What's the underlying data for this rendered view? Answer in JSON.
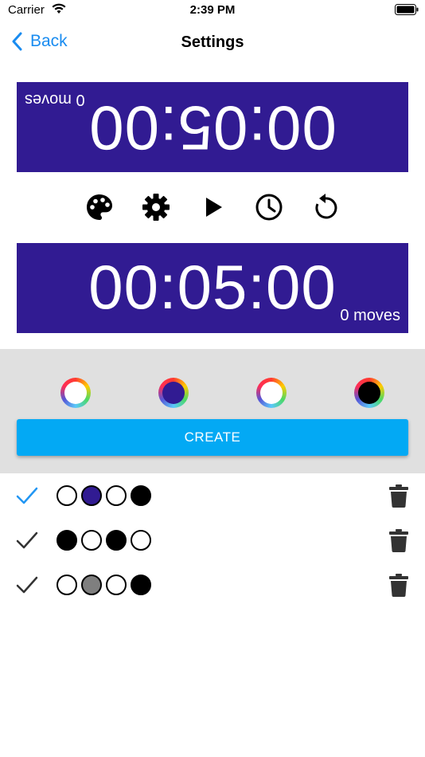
{
  "status_bar": {
    "carrier": "Carrier",
    "time": "2:39 PM"
  },
  "nav": {
    "back_label": "Back",
    "title": "Settings"
  },
  "clocks": {
    "top": {
      "time": "00:05:00",
      "moves": "0 moves",
      "background": "#311b92",
      "text_color": "#ffffff"
    },
    "bottom": {
      "time": "00:05:00",
      "moves": "0 moves",
      "background": "#311b92",
      "text_color": "#ffffff"
    }
  },
  "controls": [
    "palette-icon",
    "gear-icon",
    "play-icon",
    "clock-icon",
    "restart-icon"
  ],
  "color_pickers": [
    "#ffffff",
    "#311b92",
    "#ffffff",
    "#000000"
  ],
  "create_label": "CREATE",
  "presets": [
    {
      "selected": true,
      "colors": [
        "#ffffff",
        "#311b92",
        "#ffffff",
        "#000000"
      ]
    },
    {
      "selected": false,
      "colors": [
        "#000000",
        "#ffffff",
        "#000000",
        "#ffffff"
      ]
    },
    {
      "selected": false,
      "colors": [
        "#ffffff",
        "#7f7f7f",
        "#ffffff",
        "#000000"
      ]
    }
  ],
  "colors": {
    "accent": "#03a9f4",
    "link": "#1a8cf0",
    "check_selected": "#2196f3",
    "check_default": "#333333"
  }
}
